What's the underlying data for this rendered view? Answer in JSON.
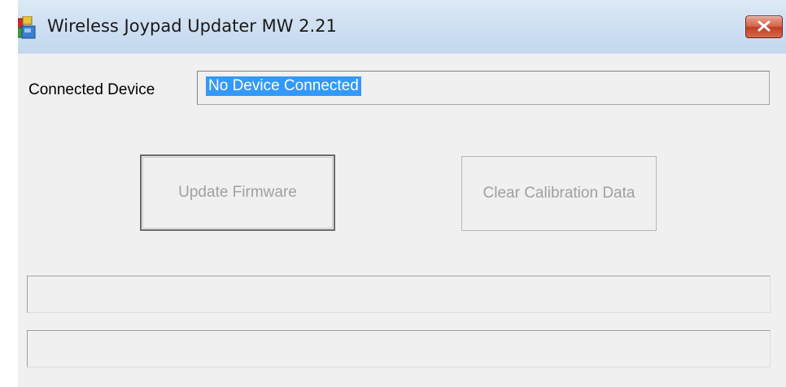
{
  "window": {
    "title": "Wireless Joypad Updater MW 2.21",
    "close_icon": "close-icon"
  },
  "device": {
    "label": "Connected Device",
    "value": "No Device Connected"
  },
  "buttons": {
    "update_firmware": "Update Firmware",
    "clear_calibration": "Clear Calibration Data"
  },
  "status": {
    "line1": "",
    "line2": ""
  },
  "colors": {
    "selection": "#3399ff",
    "close_button": "#c9462c",
    "disabled_text": "#a0a0a0"
  }
}
